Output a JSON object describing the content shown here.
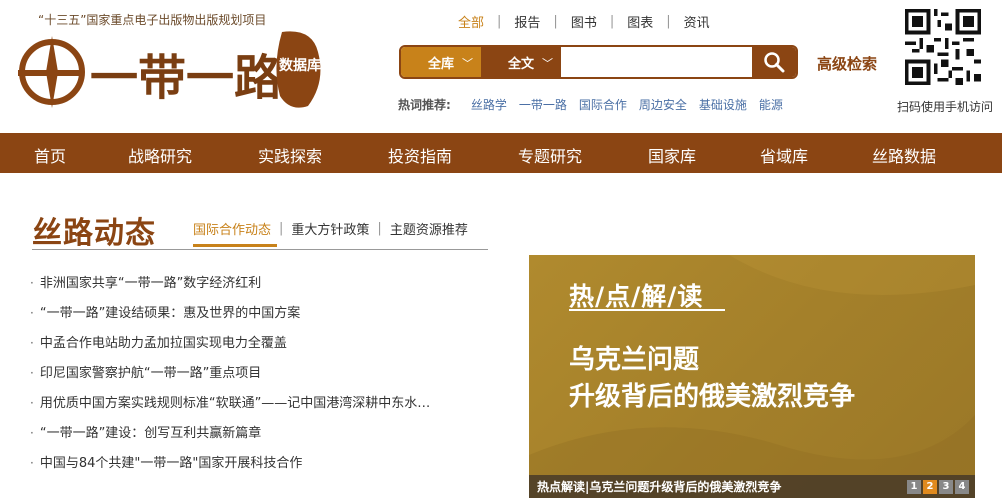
{
  "header": {
    "slogan": "“十三五”国家重点电子出版物出版规划项目",
    "logo": {
      "main_text": "一带一路",
      "seal_text": "数据库"
    },
    "top_nav": [
      {
        "label": "全部",
        "active": true
      },
      {
        "label": "报告",
        "active": false
      },
      {
        "label": "图书",
        "active": false
      },
      {
        "label": "图表",
        "active": false
      },
      {
        "label": "资讯",
        "active": false
      }
    ],
    "search": {
      "scope": "全库",
      "field": "全文",
      "placeholder": "",
      "button_icon": "search-icon"
    },
    "advanced_search": "高级检索",
    "hot": {
      "label": "热词推荐:",
      "keywords": [
        "丝路学",
        "一带一路",
        "国际合作",
        "周边安全",
        "基础设施",
        "能源"
      ]
    },
    "qr_caption": "扫码使用手机访问"
  },
  "main_nav": [
    "首页",
    "战略研究",
    "实践探索",
    "投资指南",
    "专题研究",
    "国家库",
    "省域库",
    "丝路数据"
  ],
  "section": {
    "title": "丝路动态",
    "tabs": [
      {
        "label": "国际合作动态",
        "active": true
      },
      {
        "label": "重大方针政策",
        "active": false
      },
      {
        "label": "主题资源推荐",
        "active": false
      }
    ],
    "news": [
      "非洲国家共享“一带一路”数字经济红利",
      "“一带一路”建设结硕果：惠及世界的中国方案",
      "中孟合作电站助力孟加拉国实现电力全覆盖",
      "印尼国家警察护航“一带一路”重点项目",
      "用优质中国方案实践规则标准“软联通”——记中国港湾深耕中东水…",
      "“一带一路”建设：创写互利共赢新篇章",
      "中国与84个共建\"一带一路\"国家开展科技合作"
    ]
  },
  "banner": {
    "heading": "热/点/解/读",
    "line1": "乌克兰问题",
    "line2": "升级背后的俄美激烈竞争",
    "caption": "热点解读|乌克兰问题升级背后的俄美激烈竞争",
    "pages": [
      "1",
      "2",
      "3",
      "4"
    ],
    "active_page": "2"
  },
  "colors": {
    "brand_brown": "#8b4513",
    "accent_orange": "#c8821a",
    "link_blue": "#4a6fa5",
    "banner_gold": "#a4802a"
  }
}
